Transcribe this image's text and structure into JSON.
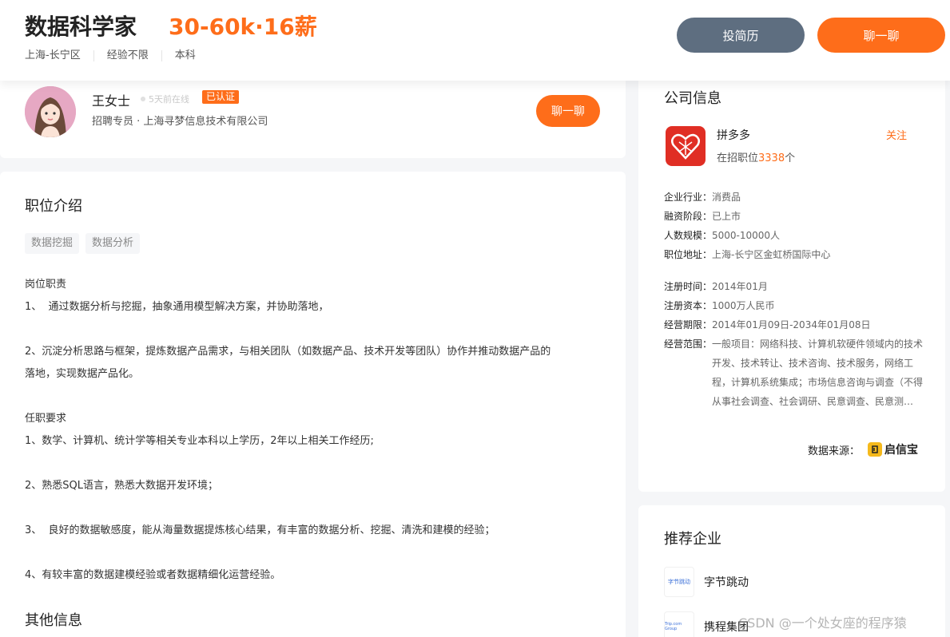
{
  "header": {
    "title": "数据科学家",
    "salary": "30-60k·16薪",
    "tags": [
      "上海-长宁区",
      "经验不限",
      "本科"
    ],
    "resume_button": "投简历",
    "chat_button": "聊一聊"
  },
  "recruiter": {
    "name": "王女士",
    "online": "5天前在线",
    "verified": "已认证",
    "company": "招聘专员 · 上海寻梦信息技术有限公司",
    "chat_button": "聊一聊"
  },
  "job": {
    "section_title": "职位介绍",
    "skills": [
      "数据挖掘",
      "数据分析"
    ],
    "lines": [
      "岗位职责",
      "1、  通过数据分析与挖掘，抽象通用模型解决方案，并协助落地，",
      "",
      "2、沉淀分析思路与框架，提炼数据产品需求，与相关团队（如数据产品、技术开发等团队）协作并推动数据产品的",
      "落地，实现数据产品化。",
      "",
      "任职要求",
      "1、数学、计算机、统计学等相关专业本科以上学历，2年以上相关工作经历;",
      "",
      "2、熟悉SQL语言，熟悉大数据开发环境；",
      "",
      "3、  良好的数据敏感度，能从海量数据提炼核心结果，有丰富的数据分析、挖掘、清洗和建模的经验；",
      "",
      "4、有较丰富的数据建模经验或者数据精细化运营经验。"
    ],
    "other_title": "其他信息"
  },
  "company": {
    "section_title": "公司信息",
    "name": "拼多多",
    "follow": "关注",
    "positions_prefix": "在招职位",
    "positions_count": "3338",
    "positions_suffix": "个",
    "industry_label": "企业行业：",
    "industry": "消费品",
    "funding_label": "融资阶段：",
    "funding": "已上市",
    "size_label": "人数规模：",
    "size": "5000-10000人",
    "address_label": "职位地址：",
    "address": "上海-长宁区金虹桥国际中心",
    "reg_date_label": "注册时间：",
    "reg_date": "2014年01月",
    "capital_label": "注册资本：",
    "capital": "1000万人民币",
    "term_label": "经营期限：",
    "term": "2014年01月09日-2034年01月08日",
    "scope_label": "经营范围：",
    "scope": "一般项目：网络科技、计算机软硬件领域内的技术开发、技术转让、技术咨询、技术服务，网络工程，计算机系统集成；市场信息咨询与调查（不得从事社会调查、社会调研、民意调查、民意测验），商务咨询；电子商务（…",
    "source_label": "数据来源：",
    "source_name": "启信宝"
  },
  "recommended": {
    "section_title": "推荐企业",
    "items": [
      {
        "name": "字节跳动",
        "logo_text": "字节跳动"
      },
      {
        "name": "携程集团",
        "logo_text": "Trip.com Group"
      }
    ]
  },
  "watermark": "CSDN @一个处女座的程序猿",
  "colors": {
    "accent": "#fe6d1a",
    "secondary_button": "#5e6e80",
    "pdd_red": "#e02e24"
  }
}
